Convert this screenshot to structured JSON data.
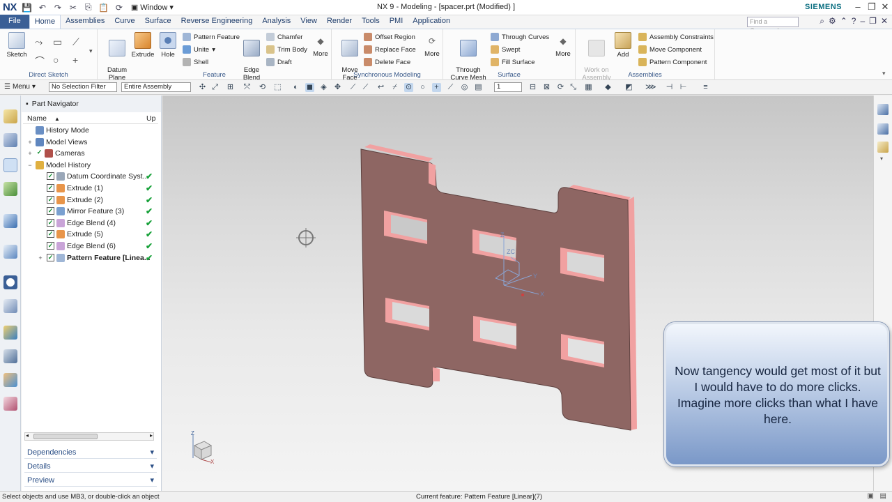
{
  "titlebar": {
    "logo": "NX",
    "window_menu": "Window",
    "title": "NX 9 - Modeling - [spacer.prt (Modified) ]",
    "brand": "SIEMENS",
    "minimize": "–",
    "restore": "❐",
    "close": "✕"
  },
  "tabs": {
    "file": "File",
    "items": [
      "Home",
      "Assemblies",
      "Curve",
      "Surface",
      "Reverse Engineering",
      "Analysis",
      "View",
      "Render",
      "Tools",
      "PMI",
      "Application"
    ],
    "active": "Home",
    "search_placeholder": "Find a Command"
  },
  "ribbon": {
    "direct_sketch": {
      "label": "Direct Sketch",
      "sketch": "Sketch"
    },
    "feature": {
      "label": "Feature",
      "datum_plane": "Datum\nPlane",
      "extrude": "Extrude",
      "hole": "Hole",
      "pattern_feature": "Pattern Feature",
      "unite": "Unite",
      "shell": "Shell",
      "edge_blend": "Edge\nBlend",
      "chamfer": "Chamfer",
      "trim_body": "Trim Body",
      "draft": "Draft",
      "more": "More"
    },
    "sync": {
      "label": "Synchronous Modeling",
      "move_face": "Move\nFace",
      "offset_region": "Offset Region",
      "replace_face": "Replace Face",
      "delete_face": "Delete Face",
      "more": "More"
    },
    "surface": {
      "label": "Surface",
      "through_curve_mesh": "Through\nCurve Mesh",
      "through_curves": "Through Curves",
      "swept": "Swept",
      "fill_surface": "Fill Surface",
      "more": "More"
    },
    "assemblies": {
      "label": "Assemblies",
      "work_on_assembly": "Work on\nAssembly",
      "add": "Add",
      "assembly_constraints": "Assembly Constraints",
      "move_component": "Move Component",
      "pattern_component": "Pattern Component"
    }
  },
  "toolbar2": {
    "menu": "Menu",
    "selection_filter": "No Selection Filter",
    "scope": "Entire Assembly",
    "layer": "1"
  },
  "navigator": {
    "title": "Part Navigator",
    "col_name": "Name",
    "col_up": "Up",
    "rows": [
      {
        "label": "History Mode",
        "level": 1
      },
      {
        "label": "Model Views",
        "level": 0
      },
      {
        "label": "Cameras",
        "level": 0
      },
      {
        "label": "Model History",
        "level": 0
      },
      {
        "label": "Datum Coordinate Syst...",
        "level": 2
      },
      {
        "label": "Extrude (1)",
        "level": 2
      },
      {
        "label": "Extrude (2)",
        "level": 2
      },
      {
        "label": "Mirror Feature (3)",
        "level": 2
      },
      {
        "label": "Edge Blend (4)",
        "level": 2
      },
      {
        "label": "Extrude (5)",
        "level": 2
      },
      {
        "label": "Edge Blend (6)",
        "level": 2
      },
      {
        "label": "Pattern Feature [Linea...",
        "level": 2
      }
    ],
    "sections": [
      "Dependencies",
      "Details",
      "Preview"
    ]
  },
  "viewport": {
    "triad_labels": {
      "z": "Z",
      "zc": "ZC",
      "y": "Y",
      "x": "X"
    },
    "mini_triad": {
      "z": "Z",
      "x": "X"
    }
  },
  "callout": {
    "text": "Now tangency would get most of it but I would have to do more clicks.  Imagine more clicks than what I have here."
  },
  "status": {
    "left": "Select objects and use MB3, or double-click an object",
    "center": "Current feature: Pattern Feature [Linear](7)"
  },
  "colors": {
    "part_face": "#8e6663",
    "part_edge": "#f2a3a3",
    "accent": "#3a5f96"
  }
}
